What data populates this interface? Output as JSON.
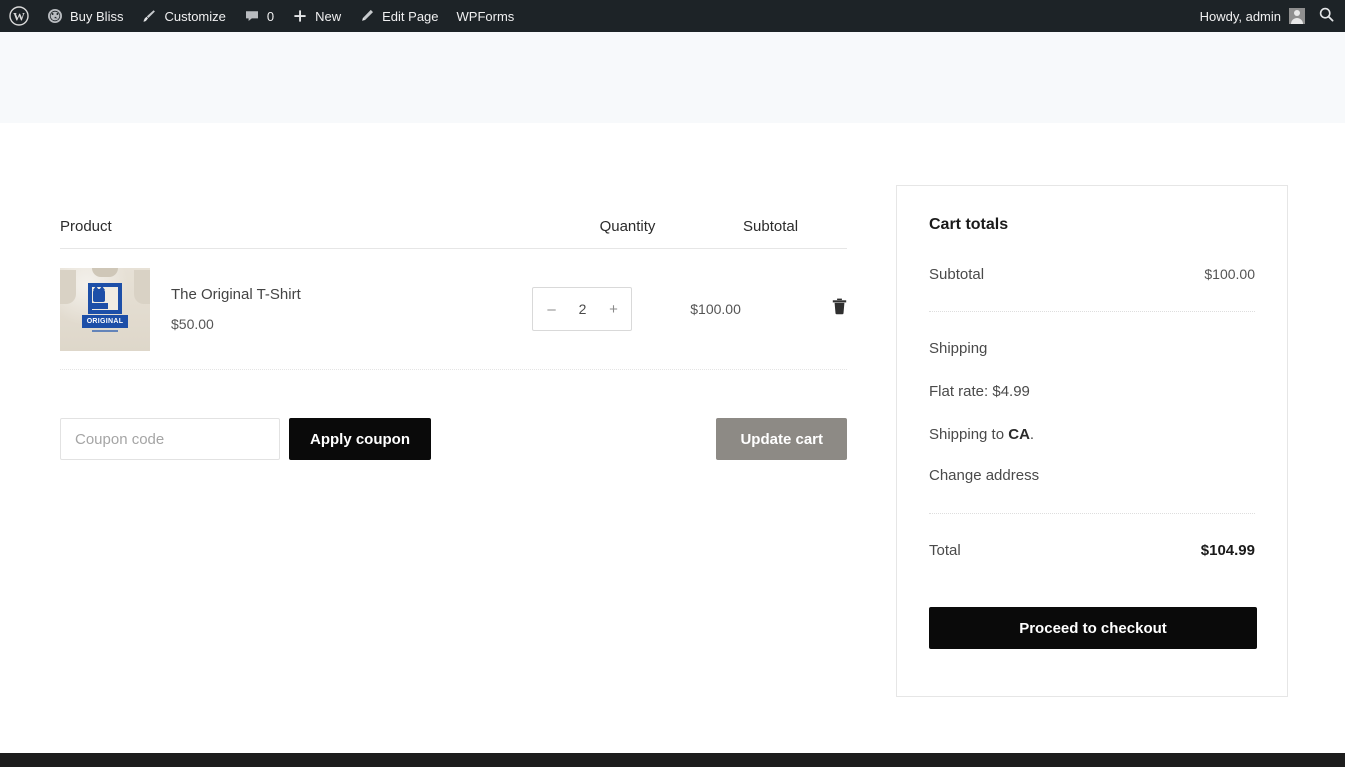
{
  "admin_bar": {
    "items": [
      {
        "icon": "wordpress-logo-icon",
        "label": ""
      },
      {
        "icon": "dashboard-icon",
        "label": "Buy Bliss"
      },
      {
        "icon": "paintbrush-icon",
        "label": "Customize"
      },
      {
        "icon": "comment-icon",
        "label": "0"
      },
      {
        "icon": "plus-icon",
        "label": "New"
      },
      {
        "icon": "pencil-icon",
        "label": "Edit Page"
      },
      {
        "icon": "",
        "label": "WPForms"
      }
    ],
    "howdy": "Howdy, admin",
    "avatar_icon": "user-avatar-icon",
    "search_icon": "search-icon"
  },
  "cart": {
    "columns": {
      "product": "Product",
      "quantity": "Quantity",
      "subtotal": "Subtotal"
    },
    "items": [
      {
        "name": "The Original T-Shirt",
        "price": "$50.00",
        "quantity": "2",
        "decrement": "–",
        "increment": "+",
        "subtotal": "$100.00",
        "remove_icon": "trash-icon",
        "thumb_print_word": "ORIGINAL"
      }
    ],
    "coupon": {
      "placeholder": "Coupon code",
      "value": "",
      "apply_label": "Apply coupon"
    },
    "update_label": "Update cart"
  },
  "totals": {
    "title": "Cart totals",
    "subtotal_label": "Subtotal",
    "subtotal_value": "$100.00",
    "shipping_label": "Shipping",
    "flat_rate": "Flat rate: $4.99",
    "shipping_to_prefix": "Shipping to ",
    "shipping_to_region": "CA",
    "shipping_to_suffix": ".",
    "change_address": "Change address",
    "total_label": "Total",
    "total_value": "$104.99",
    "checkout_label": "Proceed to checkout"
  },
  "colors": {
    "admin_bar_bg": "#1d2327",
    "banner_bg": "#f7f9fb",
    "button_black": "#0a0a0a",
    "button_disabled": "#8d8a85",
    "print_blue": "#1d4fa8",
    "footer_bg": "#1d1d1d"
  }
}
